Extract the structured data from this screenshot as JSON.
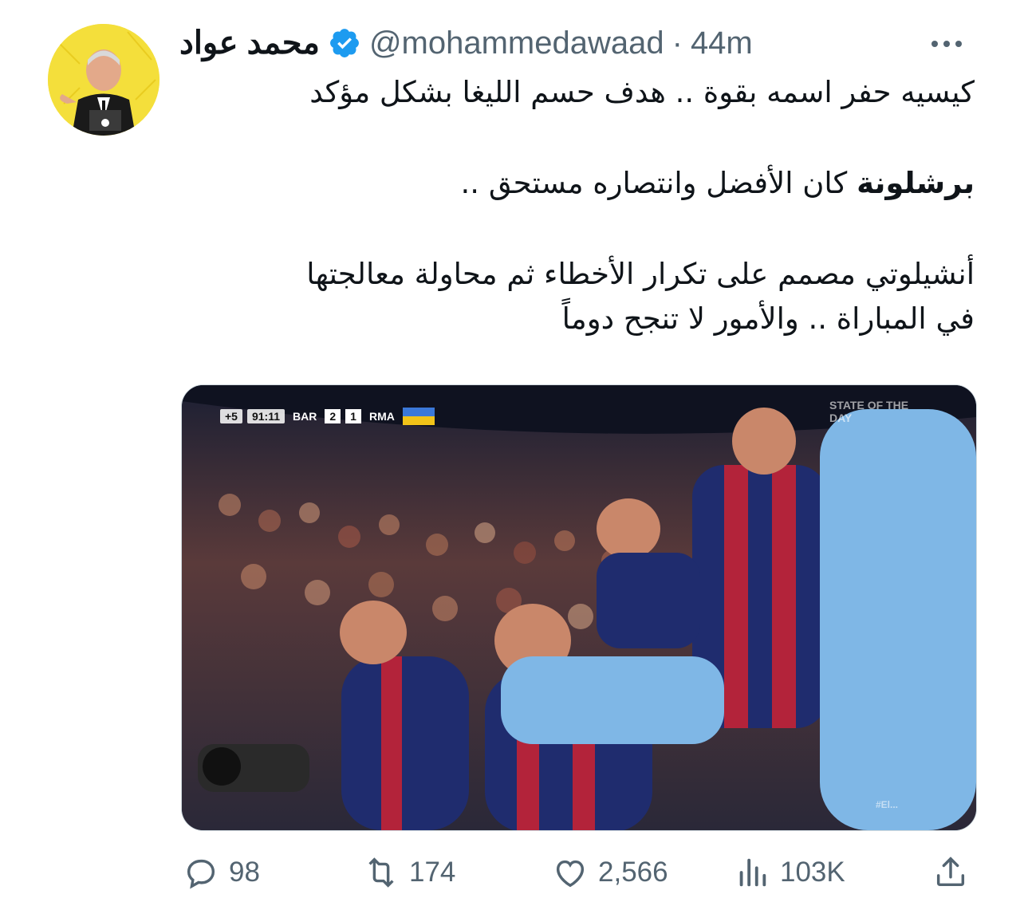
{
  "tweet": {
    "display_name": "محمد عواد",
    "handle": "@mohammedawaad",
    "separator": "·",
    "time": "44m",
    "lines": [
      "كيسيه حفر اسمه بقوة .. هدف حسم الليغا بشكل مؤكد",
      "",
      "برشلونة",
      "كان الأفضل وانتصاره مستحق ..",
      "",
      "أنشيلوتي مصمم على تكرار الأخطاء ثم محاولة معالجتها",
      "في المباراة .. والأمور لا تنجح دوماً"
    ]
  },
  "media": {
    "scoreboard": {
      "added_time": "+5",
      "clock": "91:11",
      "home": "BAR",
      "home_score": "2",
      "away_score": "1",
      "away": "RMA"
    },
    "watermark": "STATE OF THE DAY",
    "hashtag": "#El..."
  },
  "actions": {
    "replies": "98",
    "retweets": "174",
    "likes": "2,566",
    "views": "103K"
  },
  "colors": {
    "text": "#0f1419",
    "muted": "#536471",
    "verified": "#1d9bf0",
    "avatar_bg": "#f3de3a"
  },
  "icons": [
    "more-icon",
    "verified-icon",
    "reply-icon",
    "retweet-icon",
    "like-icon",
    "views-icon",
    "share-icon"
  ]
}
